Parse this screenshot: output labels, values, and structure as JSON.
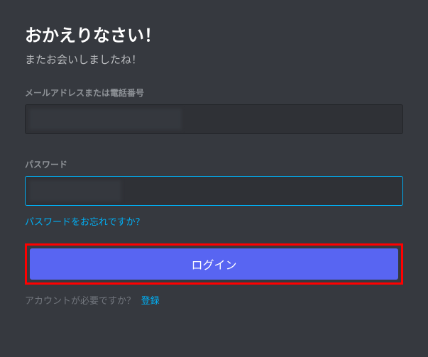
{
  "header": {
    "title": "おかえりなさい！",
    "subtitle": "またお会いしましたね！"
  },
  "form": {
    "email_label": "メールアドレスまたは電話番号",
    "email_value": "",
    "password_label": "パスワード",
    "password_value": "",
    "forgot_password": "パスワードをお忘れですか？",
    "login_button": "ログイン",
    "need_account": "アカウントが必要ですか？",
    "register": "登録"
  }
}
